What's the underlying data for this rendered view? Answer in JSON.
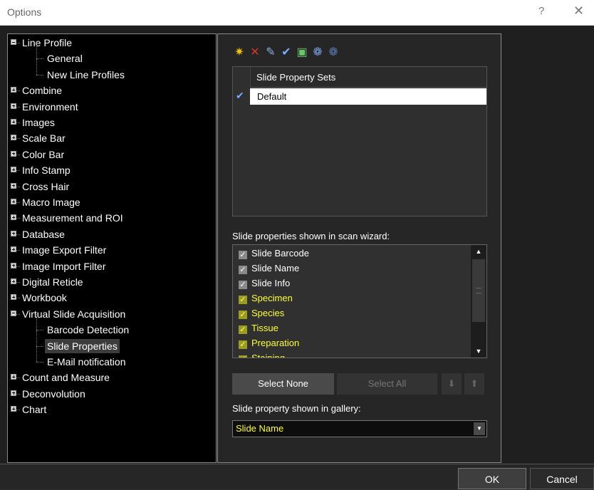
{
  "window": {
    "title": "Options",
    "help": "?",
    "close": "✕"
  },
  "tree": {
    "items": [
      {
        "label": "Line Profile",
        "level": 0,
        "expander": "minus"
      },
      {
        "label": "General",
        "level": 1
      },
      {
        "label": "New Line Profiles",
        "level": 1
      },
      {
        "label": "Combine",
        "level": 0,
        "expander": "plus"
      },
      {
        "label": "Environment",
        "level": 0,
        "expander": "plus"
      },
      {
        "label": "Images",
        "level": 0,
        "expander": "plus"
      },
      {
        "label": "Scale Bar",
        "level": 0,
        "expander": "plus"
      },
      {
        "label": "Color Bar",
        "level": 0,
        "expander": "plus"
      },
      {
        "label": "Info Stamp",
        "level": 0,
        "expander": "plus"
      },
      {
        "label": "Cross Hair",
        "level": 0,
        "expander": "plus"
      },
      {
        "label": "Macro Image",
        "level": 0,
        "expander": "plus"
      },
      {
        "label": "Measurement and ROI",
        "level": 0,
        "expander": "plus"
      },
      {
        "label": "Database",
        "level": 0,
        "expander": "plus"
      },
      {
        "label": "Image Export Filter",
        "level": 0,
        "expander": "plus"
      },
      {
        "label": "Image Import Filter",
        "level": 0,
        "expander": "plus"
      },
      {
        "label": "Digital Reticle",
        "level": 0,
        "expander": "plus"
      },
      {
        "label": "Workbook",
        "level": 0,
        "expander": "plus"
      },
      {
        "label": "Virtual Slide Acquisition",
        "level": 0,
        "expander": "minus"
      },
      {
        "label": "Barcode Detection",
        "level": 1
      },
      {
        "label": "Slide Properties",
        "level": 1,
        "selected": true
      },
      {
        "label": "E-Mail notification",
        "level": 1
      },
      {
        "label": "Count and Measure",
        "level": 0,
        "expander": "plus"
      },
      {
        "label": "Deconvolution",
        "level": 0,
        "expander": "plus"
      },
      {
        "label": "Chart",
        "level": 0,
        "expander": "plus"
      }
    ]
  },
  "toolbar": {
    "icons": [
      {
        "name": "new-set-icon",
        "glyph": "✷",
        "color": "#f5c400"
      },
      {
        "name": "delete-set-icon",
        "glyph": "✕",
        "color": "#d9342b"
      },
      {
        "name": "edit-set-icon",
        "glyph": "✎",
        "color": "#8fb0e0"
      },
      {
        "name": "apply-set-icon",
        "glyph": "✔",
        "color": "#7ab0ff"
      },
      {
        "name": "rename-set-icon",
        "glyph": "▣",
        "color": "#6ac46a"
      },
      {
        "name": "import-set-icon",
        "glyph": "❁",
        "color": "#7aa0e0"
      },
      {
        "name": "export-set-icon",
        "glyph": "❁",
        "color": "#5a7ab0"
      }
    ]
  },
  "sets_table": {
    "header": "Slide Property Sets",
    "rows": [
      "Default"
    ]
  },
  "scan_wizard": {
    "label": "Slide properties shown in scan wizard:",
    "items": [
      {
        "label": "Slide Barcode",
        "checked": true,
        "highlight": false
      },
      {
        "label": "Slide Name",
        "checked": true,
        "highlight": false
      },
      {
        "label": "Slide Info",
        "checked": true,
        "highlight": false
      },
      {
        "label": "Specimen",
        "checked": true,
        "highlight": true
      },
      {
        "label": "Species",
        "checked": true,
        "highlight": true
      },
      {
        "label": "Tissue",
        "checked": true,
        "highlight": true
      },
      {
        "label": "Preparation",
        "checked": true,
        "highlight": true
      },
      {
        "label": "Staining",
        "checked": true,
        "highlight": true
      }
    ]
  },
  "buttons": {
    "select_none": "Select None",
    "select_all": "Select All",
    "move_down": "⬇",
    "move_up": "⬆",
    "ok": "OK",
    "cancel": "Cancel"
  },
  "gallery": {
    "label": "Slide property shown in gallery:",
    "value": "Slide Name"
  },
  "colors": {
    "highlight_text": "#ffff33",
    "background": "#1f1f1f"
  }
}
